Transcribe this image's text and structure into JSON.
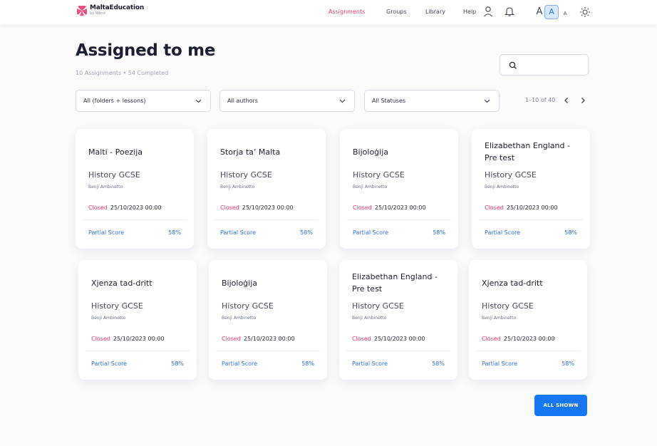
{
  "brand": {
    "name": "MaltaEducation",
    "subtitle": "by Wand"
  },
  "nav": {
    "assignments": "Assignments",
    "groups": "Groups",
    "library": "Library",
    "help": "Help"
  },
  "font_size": {
    "large": "A",
    "medium": "A",
    "small": "A",
    "selected": "medium"
  },
  "icons": {
    "logo": "maltese-cross-icon",
    "user": "user-icon",
    "bell": "bell-icon",
    "theme": "sun-icon",
    "search": "search-icon",
    "dropdown": "chevron-down-icon",
    "prev": "chevron-left-icon",
    "next": "chevron-right-icon"
  },
  "colors": {
    "accent_pink": "#e6356f",
    "accent_blue": "#1677f2",
    "link_blue": "#2f6fe0"
  },
  "page": {
    "title": "Assigned to me",
    "subtitle": "10 Assignments • 54 Completed"
  },
  "search": {
    "placeholder": ""
  },
  "filters": {
    "type": "All (folders + lessons)",
    "authors": "All authors",
    "statuses": "All Statuses"
  },
  "pagination": {
    "label": "1–10 of 40"
  },
  "cards": [
    {
      "title": "Malti - Poezija",
      "subject": "History GCSE",
      "author": "Benji Ambinetto",
      "status": "Closed",
      "date": "25/10/2023 00:00",
      "score_label": "Partial Score",
      "score": "58%"
    },
    {
      "title": "Storja ta’ Malta",
      "subject": "History GCSE",
      "author": "Benji Ambinetto",
      "status": "Closed",
      "date": "25/10/2023 00:00",
      "score_label": "Partial Score",
      "score": "58%"
    },
    {
      "title": "Bijoloġija",
      "subject": "History GCSE",
      "author": "Benji Ambinetto",
      "status": "Closed",
      "date": "25/10/2023 00:00",
      "score_label": "Partial Score",
      "score": "58%"
    },
    {
      "title": "Elizabethan England - Pre test",
      "subject": "History GCSE",
      "author": "Benji Ambinetto",
      "status": "Closed",
      "date": "25/10/2023 00:00",
      "score_label": "Partial Score",
      "score": "58%"
    },
    {
      "title": "Xjenza tad-dritt",
      "subject": "History GCSE",
      "author": "Benji Ambinetto",
      "status": "Closed",
      "date": "25/10/2023 00:00",
      "score_label": "Partial Score",
      "score": "58%"
    },
    {
      "title": "Bijoloġija",
      "subject": "History GCSE",
      "author": "Benji Ambinetto",
      "status": "Closed",
      "date": "25/10/2023 00:00",
      "score_label": "Partial Score",
      "score": "58%"
    },
    {
      "title": "Elizabethan England - Pre test",
      "subject": "History GCSE",
      "author": "Benji Ambinetto",
      "status": "Closed",
      "date": "25/10/2023 00:00",
      "score_label": "Partial Score",
      "score": "58%"
    },
    {
      "title": "Xjenza tad-dritt",
      "subject": "History GCSE",
      "author": "Benji Ambinetto",
      "status": "Closed",
      "date": "25/10/2023 00:00",
      "score_label": "Partial Score",
      "score": "58%"
    }
  ],
  "footer": {
    "all_shown": "ALL SHOWN"
  }
}
